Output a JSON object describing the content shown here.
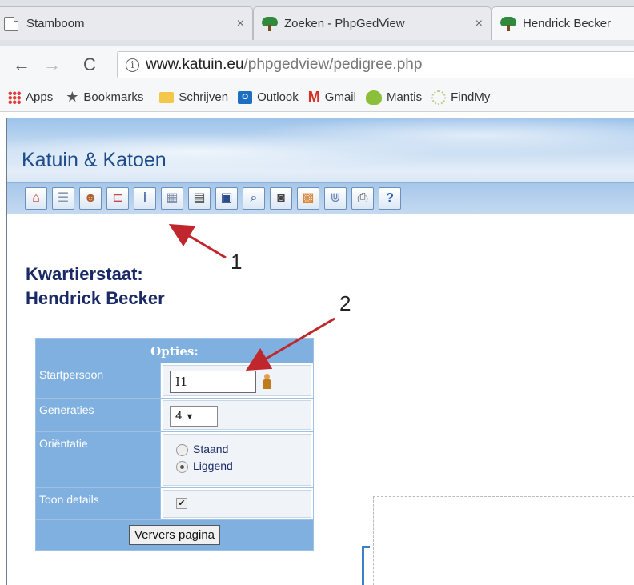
{
  "tabs": [
    {
      "title": "Stamboom",
      "close": "×",
      "icon": "document-icon"
    },
    {
      "title": "Zoeken - PhpGedView",
      "close": "×",
      "icon": "tree-icon"
    },
    {
      "title": "Hendrick Becker",
      "close": "",
      "icon": "tree-icon"
    }
  ],
  "address": {
    "domain": "www.katuin.eu",
    "path": "/phpgedview/pedigree.php"
  },
  "bookmarks": [
    {
      "label": "Apps",
      "icon": "apps-grid-icon"
    },
    {
      "label": "Bookmarks",
      "icon": "star-icon"
    },
    {
      "label": "Schrijven",
      "icon": "folder-icon"
    },
    {
      "label": "Outlook",
      "icon": "outlook-icon"
    },
    {
      "label": "Gmail",
      "icon": "gmail-icon"
    },
    {
      "label": "Mantis",
      "icon": "mantis-icon"
    },
    {
      "label": "FindMy",
      "icon": "findmy-icon"
    }
  ],
  "site": {
    "title": "Katuin & Katoen"
  },
  "toolbar_icons": [
    "home-icon",
    "list-icon",
    "person-icon",
    "pedigree-icon",
    "individual-icon",
    "calendar-icon",
    "document-icon",
    "save-icon",
    "search-icon",
    "camera-icon",
    "map-icon",
    "book-icon",
    "print-icon",
    "help-icon"
  ],
  "heading": {
    "line1": "Kwartierstaat:",
    "line2": "Hendrick Becker"
  },
  "options": {
    "header": "Opties:",
    "start_label": "Startpersoon",
    "start_value": "I1",
    "gen_label": "Generaties",
    "gen_value": "4",
    "orient_label": "Oriëntatie",
    "orient_portrait": "Staand",
    "orient_landscape": "Liggend",
    "orient_selected": "Liggend",
    "details_label": "Toon details",
    "details_checked": true,
    "submit": "Ververs pagina"
  },
  "annotations": {
    "one": "1",
    "two": "2"
  },
  "colors": {
    "accent_blue": "#7fb0e0",
    "heading_navy": "#1a2a66",
    "arrow_red": "#c0272d"
  }
}
